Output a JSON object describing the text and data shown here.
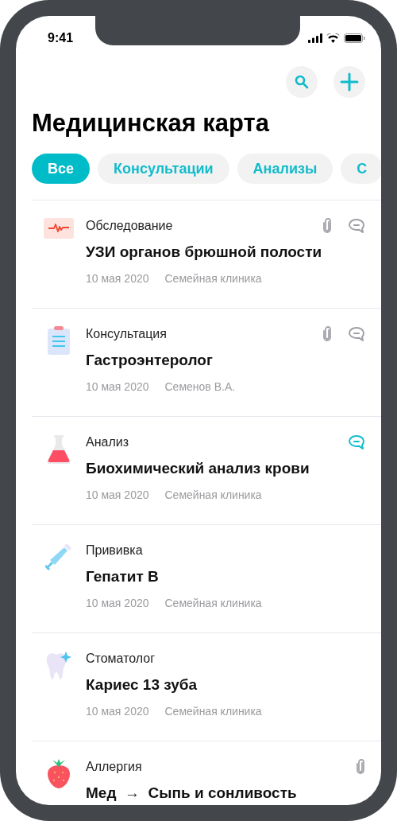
{
  "status_bar": {
    "time": "9:41"
  },
  "title": "Медицинская карта",
  "filters": [
    {
      "label": "Все",
      "selected": true
    },
    {
      "label": "Консультации",
      "selected": false
    },
    {
      "label": "Анализы",
      "selected": false
    },
    {
      "label": "С",
      "selected": false
    }
  ],
  "records": [
    {
      "kind": "heartbeat",
      "category": "Обследование",
      "title": "УЗИ органов брюшной полости",
      "date": "10 мая 2020",
      "place": "Семейная клиника",
      "attachment": true,
      "comment": true,
      "unread": false
    },
    {
      "kind": "clipboard",
      "category": "Консультация",
      "title": "Гастроэнтеролог",
      "date": "10 мая 2020",
      "place": "Семенов В.А.",
      "attachment": true,
      "comment": true,
      "unread": false
    },
    {
      "kind": "flask",
      "category": "Анализ",
      "title": "Биохимический анализ крови",
      "date": "10 мая 2020",
      "place": "Семейная клиника",
      "attachment": false,
      "comment": true,
      "unread": true
    },
    {
      "kind": "syringe",
      "category": "Прививка",
      "title": "Гепатит В",
      "date": "10 мая 2020",
      "place": "Семейная клиника",
      "attachment": false,
      "comment": false
    },
    {
      "kind": "tooth",
      "category": "Стоматолог",
      "title": "Кариес 13 зуба",
      "date": "10 мая 2020",
      "place": "Семейная клиника",
      "attachment": false,
      "comment": false
    },
    {
      "kind": "strawberry",
      "category": "Аллергия",
      "title": "Мед  →  Сыпь и сонливость",
      "attachment": true,
      "comment": false
    }
  ]
}
